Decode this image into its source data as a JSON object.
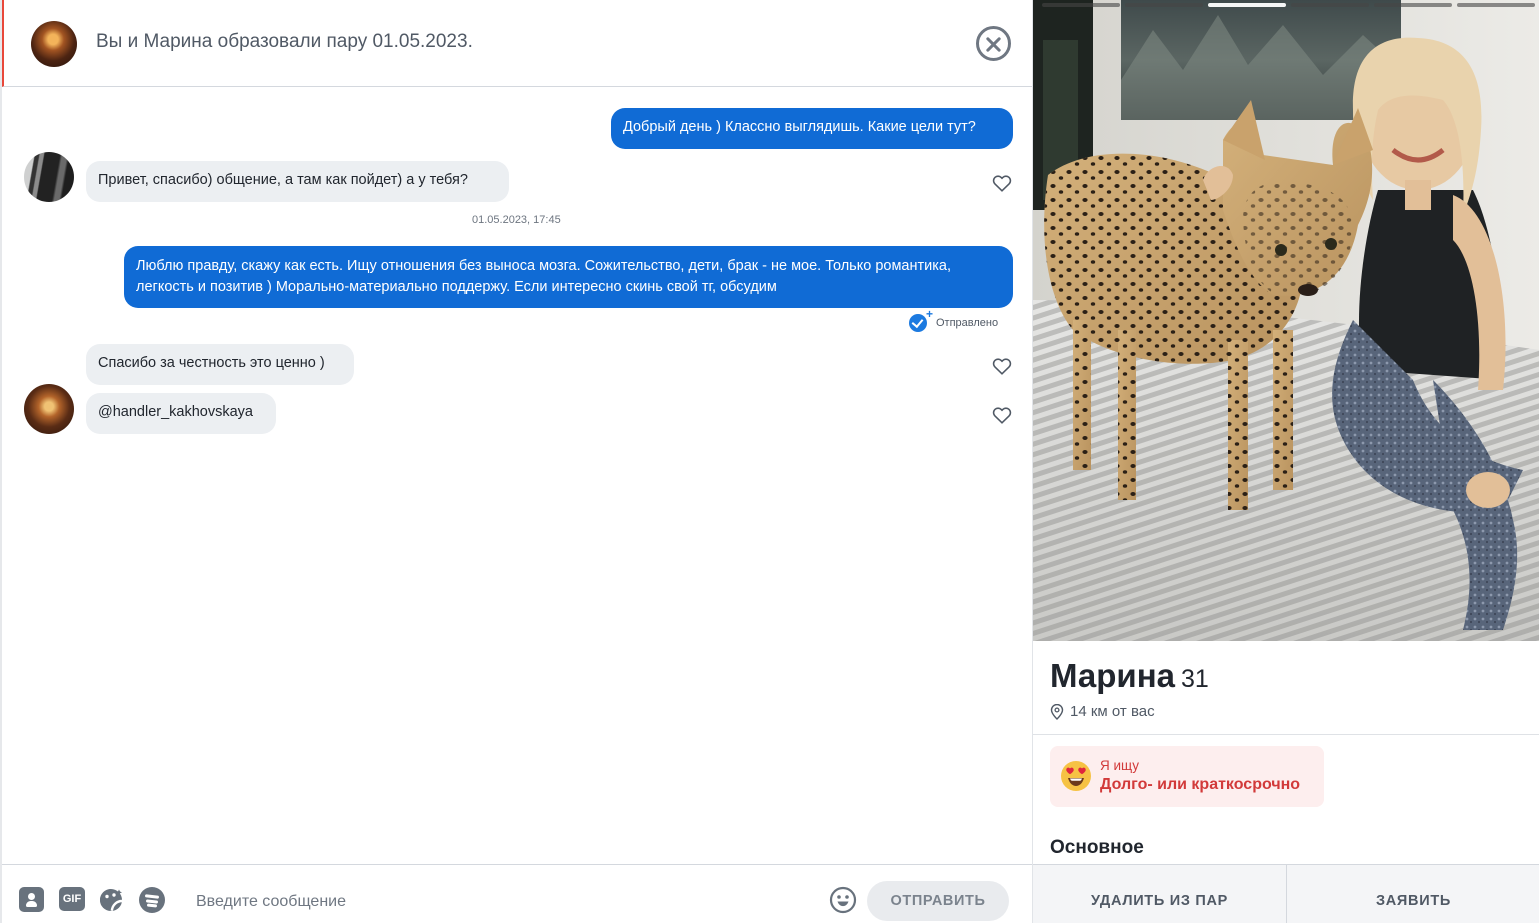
{
  "header": {
    "title": "Вы и Марина образовали пару 01.05.2023."
  },
  "messages": [
    {
      "text": "Добрый день ) Классно выглядишь. Какие цели тут?"
    },
    {
      "text": "Привет, спасибо) общение, а там как пойдет) а у тебя?"
    },
    {
      "text": "Люблю правду, скажу как есть. Ищу отношения без выноса мозга. Сожительство, дети, брак - не мое. Только романтика, легкость и позитив ) Морально-материально поддержу. Если интересно скинь свой тг, обсудим"
    },
    {
      "text": "Спасибо за честность это ценно )"
    },
    {
      "text": "@handler_kakhovskaya"
    }
  ],
  "timestamp": "01.05.2023, 17:45",
  "status_sent": "Отправлено",
  "composer": {
    "gif_label": "GIF",
    "placeholder": "Введите сообщение",
    "send_label": "ОТПРАВИТЬ"
  },
  "profile": {
    "name": "Марина",
    "age": "31",
    "distance": "14 км от вас",
    "looking_for_label": "Я ищу",
    "looking_for_value": "Долго- или краткосрочно",
    "basics_title": "Основное",
    "photo_count": 6,
    "active_photo": 3,
    "remove_label": "УДАЛИТЬ ИЗ ПАР",
    "report_label": "ЗАЯВИТЬ"
  },
  "colors": {
    "accent_blue": "#106bd5",
    "incoming_bubble": "#eceff2",
    "looking_for_red": "#d23a3a",
    "header_accent": "#e8483a"
  }
}
